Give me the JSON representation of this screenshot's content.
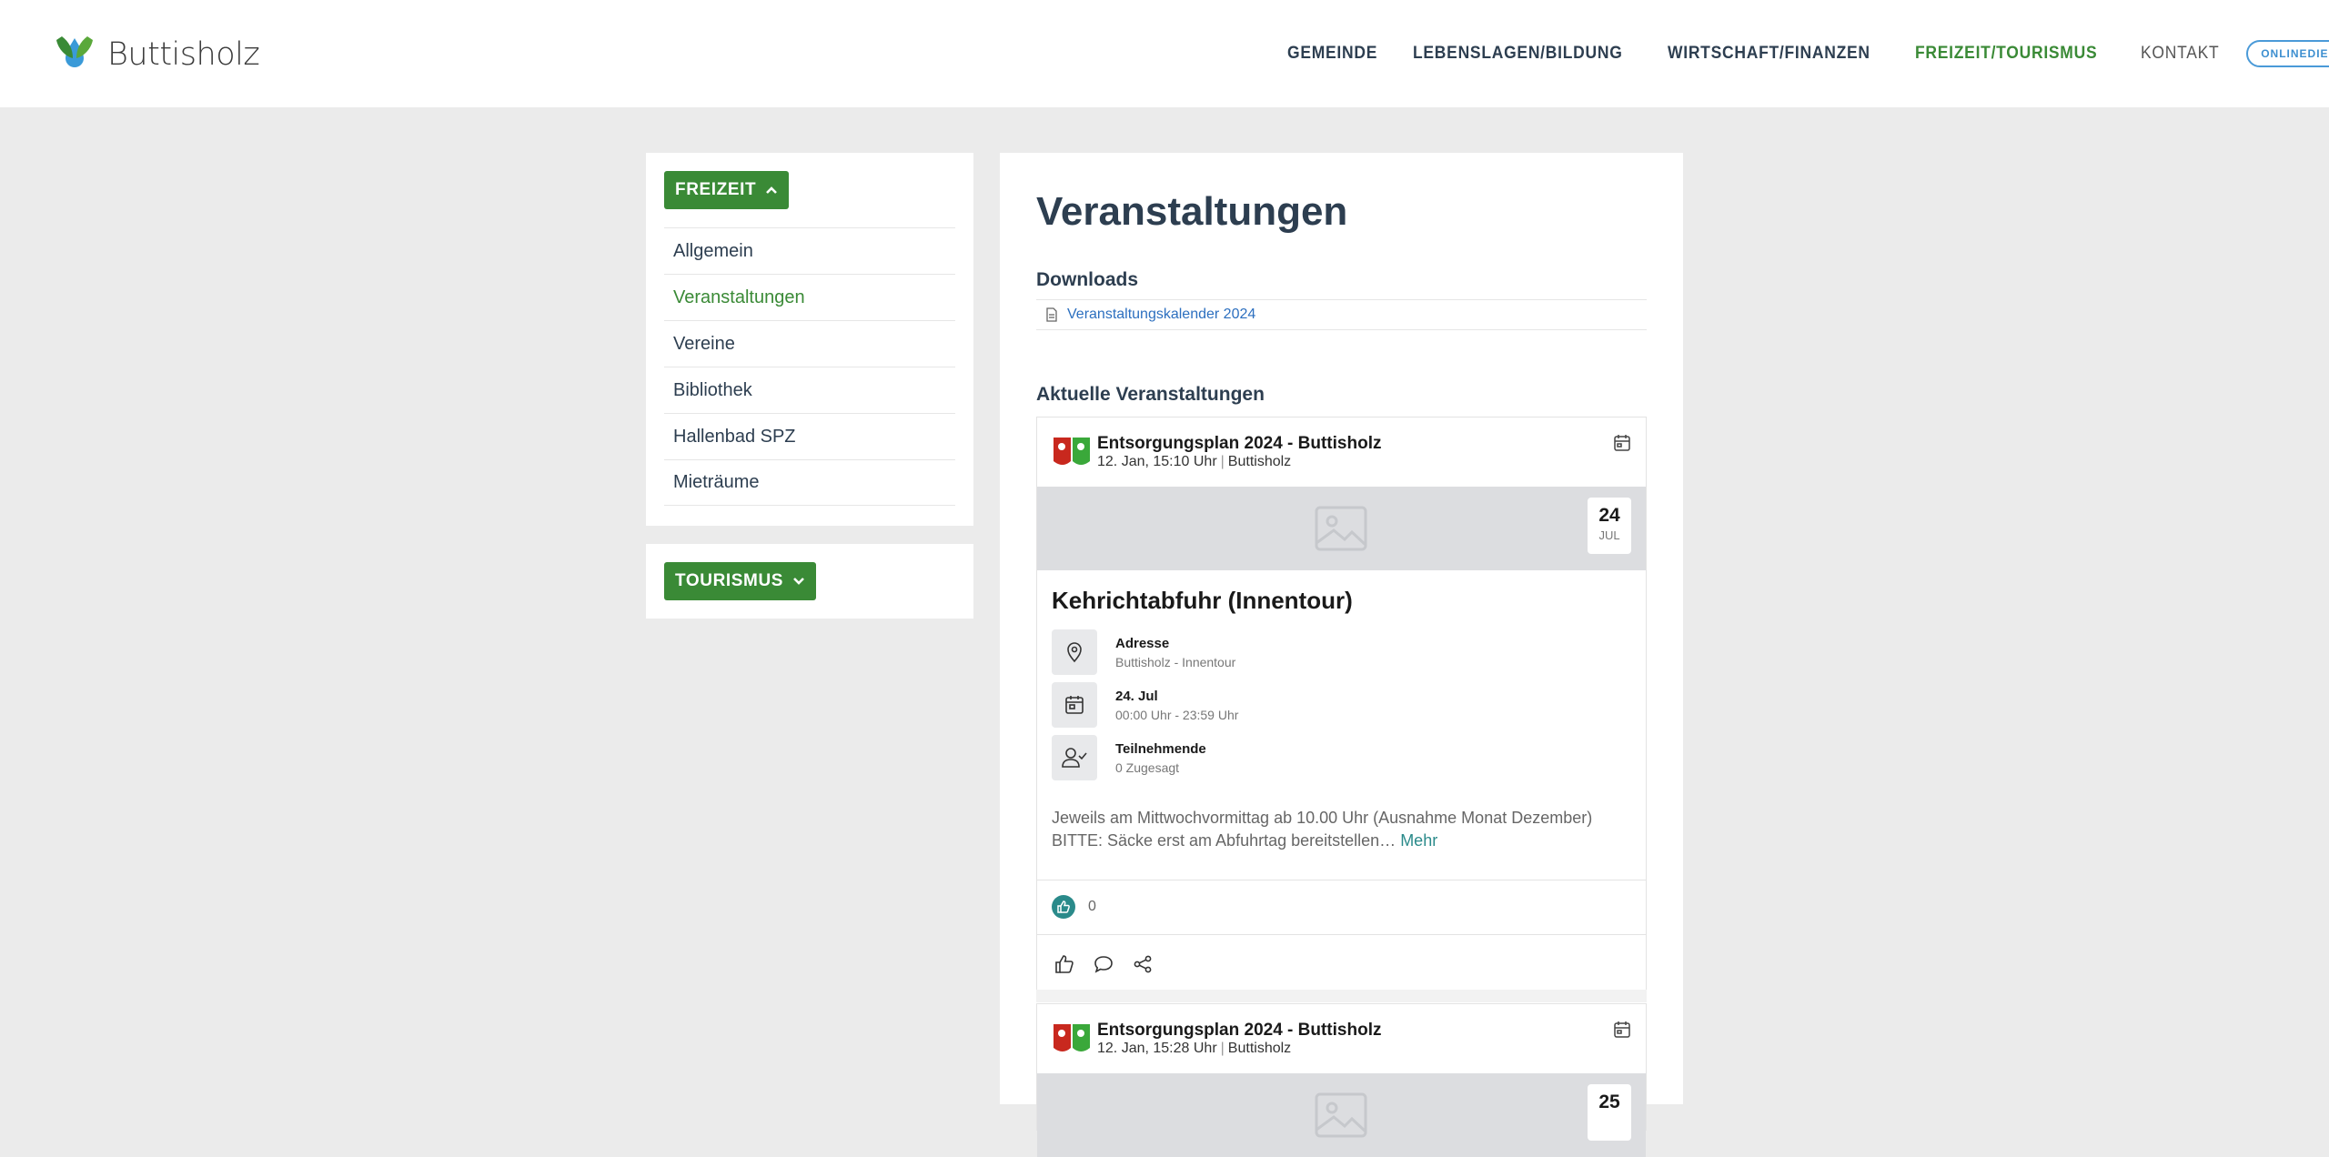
{
  "brand": {
    "name": "Buttisholz"
  },
  "nav": {
    "items": [
      {
        "label": "GEMEINDE"
      },
      {
        "label": "LEBENSLAGEN/BILDUNG"
      },
      {
        "label": "WIRTSCHAFT/FINANZEN"
      },
      {
        "label": "FREIZEIT/TOURISMUS"
      },
      {
        "label": "KONTAKT"
      }
    ],
    "online_label": "ONLINEDIENSTE"
  },
  "sidebar": {
    "freizeit_label": "FREIZEIT",
    "items": [
      {
        "label": "Allgemein"
      },
      {
        "label": "Veranstaltungen"
      },
      {
        "label": "Vereine"
      },
      {
        "label": "Bibliothek"
      },
      {
        "label": "Hallenbad SPZ"
      },
      {
        "label": "Mieträume"
      }
    ],
    "tourismus_label": "TOURISMUS"
  },
  "main": {
    "title": "Veranstaltungen",
    "downloads_title": "Downloads",
    "download_link": "Veranstaltungskalender 2024",
    "events_title": "Aktuelle Veranstaltungen"
  },
  "events": [
    {
      "org": "Entsorgungsplan 2024 - Buttisholz",
      "time": "12. Jan, 15:10 Uhr",
      "place": "Buttisholz",
      "day": "24",
      "month": "JUL",
      "title": "Kehrichtabfuhr (Innentour)",
      "address_label": "Adresse",
      "address_value": "Buttisholz - Innentour",
      "date_label": "24. Jul",
      "date_value": "00:00 Uhr - 23:59 Uhr",
      "participants_label": "Teilnehmende",
      "participants_value": "0 Zugesagt",
      "description": "Jeweils am Mittwochvormittag ab 10.00 Uhr (Ausnahme Monat Dezember) BITTE: Säcke erst am Abfuhrtag bereitstellen…",
      "more": "Mehr",
      "likes": "0"
    },
    {
      "org": "Entsorgungsplan 2024 - Buttisholz",
      "time": "12. Jan, 15:28 Uhr",
      "place": "Buttisholz",
      "day": "25"
    }
  ],
  "colors": {
    "green": "#3a8a36",
    "navy": "#2d3e50",
    "teal": "#2a8a8a",
    "link_blue": "#2c6fbf"
  }
}
